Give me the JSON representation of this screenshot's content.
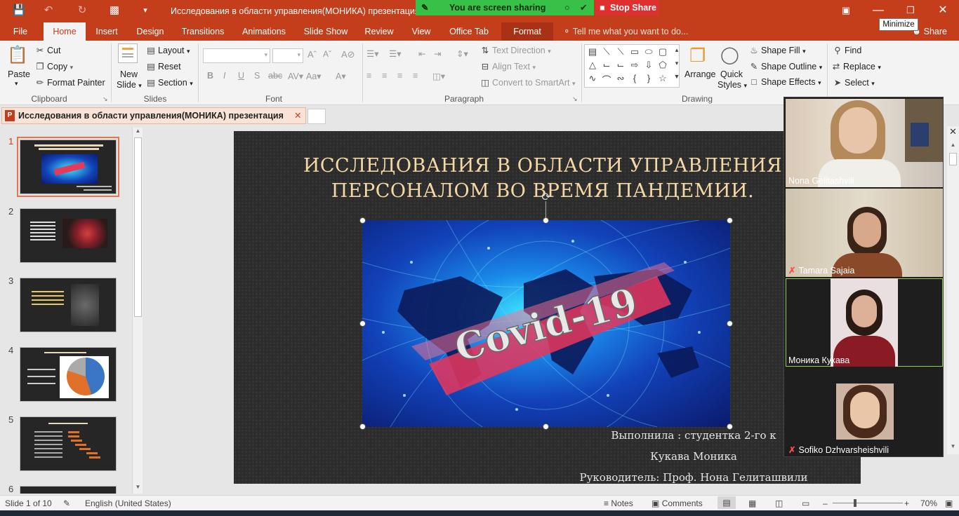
{
  "window": {
    "title": "Исследования в области управления(МОНИКА) презентация - ",
    "minimize_tooltip": "Minimize"
  },
  "screen_share": {
    "status": "You are screen sharing",
    "stop_label": "Stop Share"
  },
  "menu": {
    "tabs": [
      "File",
      "Home",
      "Insert",
      "Design",
      "Transitions",
      "Animations",
      "Slide Show",
      "Review",
      "View",
      "Office Tab",
      "Format"
    ],
    "active_tab": "Home",
    "tell_me": "Tell me what you want to do...",
    "share_label": "Share"
  },
  "ribbon": {
    "clipboard": {
      "label": "Clipboard",
      "paste": "Paste",
      "cut": "Cut",
      "copy": "Copy",
      "format_painter": "Format Painter"
    },
    "slides": {
      "label": "Slides",
      "new_slide_1": "New",
      "new_slide_2": "Slide",
      "layout": "Layout",
      "reset": "Reset",
      "section": "Section"
    },
    "font": {
      "label": "Font"
    },
    "paragraph": {
      "label": "Paragraph",
      "text_direction": "Text Direction",
      "align_text": "Align Text",
      "convert_smartart": "Convert to SmartArt"
    },
    "drawing": {
      "label": "Drawing",
      "arrange": "Arrange",
      "quick_styles_1": "Quick",
      "quick_styles_2": "Styles",
      "shape_fill": "Shape Fill",
      "shape_outline": "Shape Outline",
      "shape_effects": "Shape Effects"
    },
    "editing": {
      "find": "Find",
      "replace": "Replace",
      "select": "Select"
    }
  },
  "document_tab": {
    "name": "Исследования в области управления(МОНИКА)  презентация"
  },
  "thumbnails": [
    "1",
    "2",
    "3",
    "4",
    "5",
    "6"
  ],
  "slide": {
    "title_line1": "ИССЛЕДОВАНИЯ В ОБЛАСТИ УПРАВЛЕНИЯ",
    "title_line2": "ПЕРСОНАЛОМ ВО ВРЕМЯ ПАНДЕМИИ.",
    "picture_text": "Covid-19",
    "sub1": "Выполнила : студентка 2-го к",
    "sub2": "Кукава Моника",
    "sub3": "Руководитель: Проф. Нона Гелиташвили"
  },
  "participants": [
    {
      "name": "Nona Gelitashvili",
      "muted": false
    },
    {
      "name": "Tamara Sajaia",
      "muted": true
    },
    {
      "name": "Моника Кукава",
      "muted": false
    },
    {
      "name": "Sofiko Dzhvarsheishvili",
      "muted": true
    }
  ],
  "status": {
    "slide_info": "Slide 1 of 10",
    "language": "English (United States)",
    "notes": "Notes",
    "comments": "Comments",
    "zoom": "70%"
  },
  "colors": {
    "accent": "#c43e1c",
    "share_green": "#38c148",
    "stop_red": "#e02f2f",
    "title_gold": "#f5d9a5"
  }
}
